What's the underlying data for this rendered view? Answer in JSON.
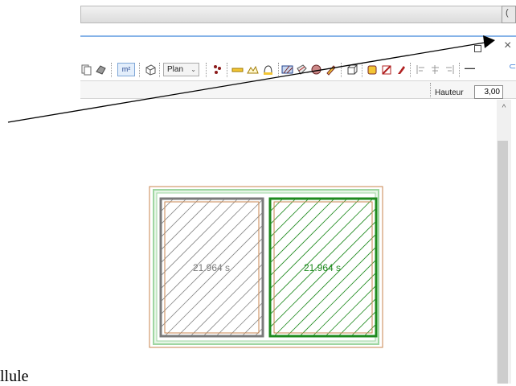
{
  "titlebar": {
    "right_glyph": "("
  },
  "window": {
    "close_glyph": "×"
  },
  "toolbar": {
    "m2_label": "m²",
    "plan_select": {
      "value": "Plan",
      "chevron": "⌄"
    },
    "right_glyph": "—"
  },
  "properties": {
    "hauteur_label": "Hauteur",
    "hauteur_value": "3,00"
  },
  "scroll": {
    "up_glyph": "^"
  },
  "plan": {
    "room_left": {
      "label": "21.964 s"
    },
    "room_right": {
      "label": "21.964 s"
    }
  },
  "background_text": "llule",
  "colors": {
    "green": "#1e8a1e",
    "gray": "#7a7a7a",
    "orange": "#c8864f",
    "light_green": "#9fd6a2"
  }
}
